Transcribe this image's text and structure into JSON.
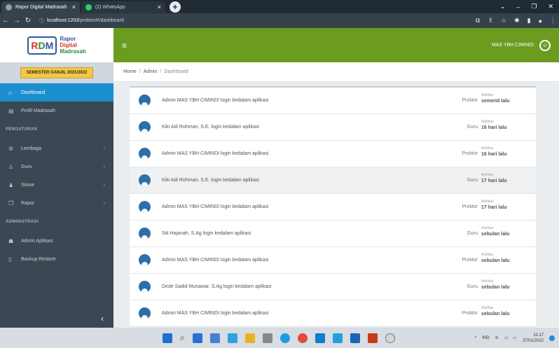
{
  "browser": {
    "tabs": [
      {
        "title": "Rapor Digital Madrasah",
        "active": true
      },
      {
        "title": "(2) WhatsApp",
        "active": false
      }
    ],
    "url_host": "localhost:1203",
    "url_path": "/proktor#!/dashboard"
  },
  "logo": {
    "mark_left": "R",
    "mark_mid": "D",
    "mark_right": "M",
    "line1": "Rapor",
    "line2": "Digital",
    "line3": "Madrasah"
  },
  "semester": "SEMESTER GANJIL 2021/2022",
  "sidebar": {
    "items_top": [
      {
        "label": "Dashboard",
        "icon": "home-icon",
        "active": true
      },
      {
        "label": "Profil Madrasah",
        "icon": "document-icon",
        "active": false
      }
    ],
    "header1": "PENGATURAN",
    "items_mid": [
      {
        "label": "Lembaga",
        "icon": "gears-icon"
      },
      {
        "label": "Guru",
        "icon": "user-icon"
      },
      {
        "label": "Siswa",
        "icon": "students-icon"
      },
      {
        "label": "Rapor",
        "icon": "copy-icon"
      }
    ],
    "header2": "ADMINISTRASI",
    "items_bottom": [
      {
        "label": "Admin Aplikasi",
        "icon": "users-icon"
      },
      {
        "label": "Backup Restore",
        "icon": "file-icon"
      }
    ]
  },
  "topbar": {
    "user_name": "MAS YBH CIMINDI"
  },
  "breadcrumb": {
    "home": "Home",
    "admin": "Admin",
    "current": "Dashboard"
  },
  "activity_label": "Aktifitas",
  "activities": [
    {
      "message": "Admin MAS YBH CIMINDI login kedalam aplikasi",
      "role": "Proktor",
      "time": "semenit lalu"
    },
    {
      "message": "Kiki Adi Rohman, S.E. login kedalam aplikasi",
      "role": "Guru",
      "time": "16 hari lalu"
    },
    {
      "message": "Admin MAS YBH CIMINDI login kedalam aplikasi",
      "role": "Proktor",
      "time": "16 hari lalu"
    },
    {
      "message": "Kiki Adi Rohman, S.E. login kedalam aplikasi",
      "role": "Guru",
      "time": "17 hari lalu"
    },
    {
      "message": "Admin MAS YBH CIMINDI login kedalam aplikasi",
      "role": "Proktor",
      "time": "17 hari lalu"
    },
    {
      "message": "Siti Hajanah, S.Ag login kedalam aplikasi",
      "role": "Guru",
      "time": "sebulan lalu"
    },
    {
      "message": "Admin MAS YBH CIMINDI login kedalam aplikasi",
      "role": "Proktor",
      "time": "sebulan lalu"
    },
    {
      "message": "Dede Sadid Munawar, S.Ag login kedalam aplikasi",
      "role": "Guru",
      "time": "sebulan lalu"
    },
    {
      "message": "Admin MAS YBH CIMINDI login kedalam aplikasi",
      "role": "Proktor",
      "time": "sebulan lalu"
    }
  ],
  "taskbar": {
    "lang": "IND",
    "time": "11:17",
    "date": "27/01/2022"
  },
  "colors": {
    "topbar": "#6b9c1f",
    "sidebar": "#3b4753",
    "active": "#1b8fd0",
    "user_icon": "#2d6fa6"
  }
}
